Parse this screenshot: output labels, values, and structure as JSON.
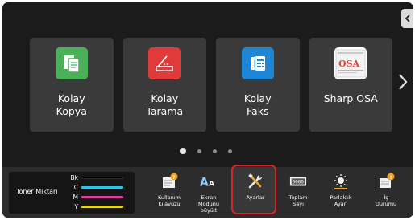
{
  "tiles": [
    {
      "label": "Kolay\nKopya",
      "icon": "copy-icon",
      "color": "#4caf5a"
    },
    {
      "label": "Kolay\nTarama",
      "icon": "scan-icon",
      "color": "#e03a3a"
    },
    {
      "label": "Kolay\nFaks",
      "icon": "fax-icon",
      "color": "#1f86d6"
    },
    {
      "label": "Sharp OSA",
      "icon": "sharp-osa-icon",
      "color": "#ffffff"
    }
  ],
  "pager": {
    "pages": 4,
    "active": 1
  },
  "toner": {
    "label": "Toner Miktarı",
    "rows": [
      {
        "name": "Bk",
        "color": "#000000",
        "level": 1.0
      },
      {
        "name": "C",
        "color": "#2bc7e6",
        "level": 1.0
      },
      {
        "name": "M",
        "color": "#e0409a",
        "level": 1.0
      },
      {
        "name": "Y",
        "color": "#e6d22b",
        "level": 1.0
      }
    ]
  },
  "bottom_buttons": [
    {
      "label": "Kullanım\nKılavuzu",
      "icon": "manual-icon"
    },
    {
      "label": "Ekran Modunu\nbüyült",
      "icon": "font-size-icon"
    },
    {
      "label": "Ayarlar",
      "icon": "settings-icon",
      "highlighted": true
    },
    {
      "label": "Toplam\nSayı",
      "icon": "counter-icon"
    },
    {
      "label": "Parlaklık\nAyarı",
      "icon": "brightness-icon"
    },
    {
      "label": "İş\nDurumu",
      "icon": "job-status-icon"
    }
  ],
  "colors": {
    "panel": "#1b1b1b",
    "tile": "#3a3a3a",
    "highlight": "#d6242c"
  }
}
